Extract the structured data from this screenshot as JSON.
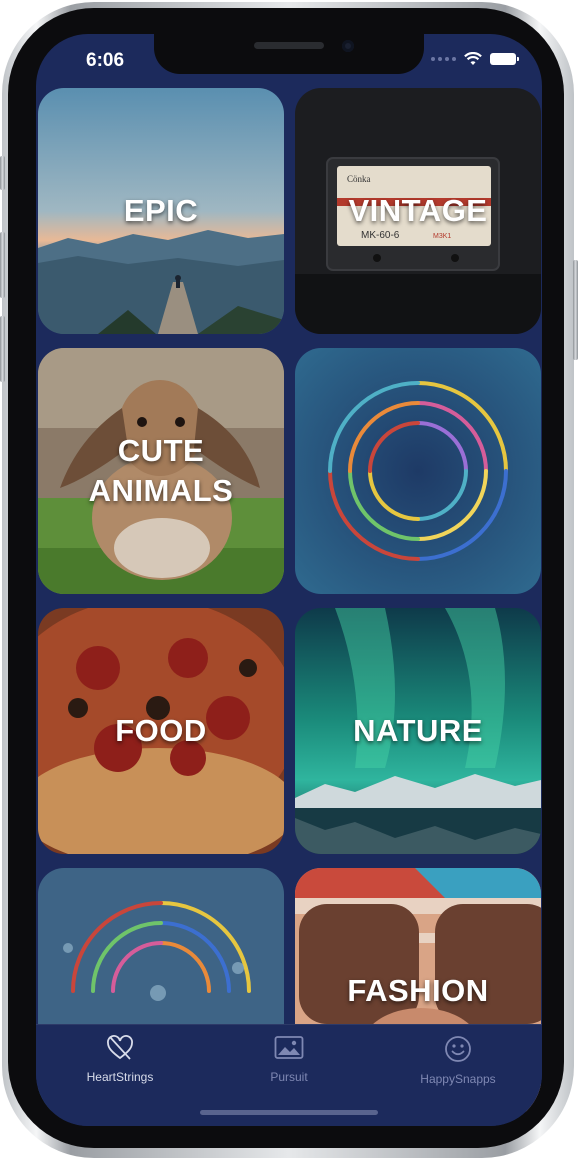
{
  "status_bar": {
    "time": "6:06"
  },
  "tiles": [
    {
      "label": "EPIC"
    },
    {
      "label": "VINTAGE",
      "tape_brand": "Cönka",
      "tape_model": "MK-60-6",
      "tape_side": "M3K1"
    },
    {
      "label": "CUTE\nANIMALS"
    },
    {
      "label": ""
    },
    {
      "label": "FOOD"
    },
    {
      "label": "NATURE"
    },
    {
      "label": ""
    },
    {
      "label": "FASHION"
    }
  ],
  "tab_bar": {
    "tabs": [
      {
        "label": "HeartStrings",
        "icon": "heart-slash-icon",
        "active": true
      },
      {
        "label": "Pursuit",
        "icon": "photo-icon",
        "active": false
      },
      {
        "label": "HappySnapps",
        "icon": "smiley-icon",
        "active": false
      }
    ]
  },
  "colors": {
    "background": "#1c2a5c",
    "tab_active": "#d8dcea",
    "tab_inactive": "#7f88b3"
  }
}
